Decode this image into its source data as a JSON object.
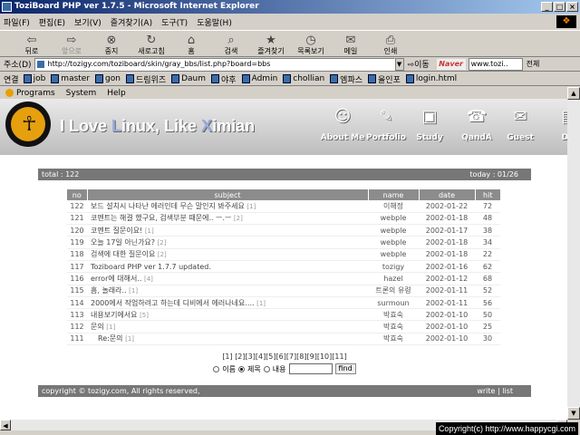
{
  "window": {
    "title": "ToziBoard PHP ver 1.7.5 - Microsoft Internet Explorer"
  },
  "menu": [
    "파일(F)",
    "편집(E)",
    "보기(V)",
    "즐겨찾기(A)",
    "도구(T)",
    "도움말(H)"
  ],
  "toolbar": [
    {
      "label": "뒤로",
      "icon": "back-arrow-icon",
      "glyph": "⇦"
    },
    {
      "label": "앞으로",
      "icon": "forward-arrow-icon",
      "glyph": "⇨",
      "disabled": true
    },
    {
      "label": "중지",
      "icon": "stop-icon",
      "glyph": "⊗"
    },
    {
      "label": "새로고침",
      "icon": "refresh-icon",
      "glyph": "↻"
    },
    {
      "label": "홈",
      "icon": "home-icon",
      "glyph": "⌂"
    },
    {
      "label": "검색",
      "icon": "search-icon",
      "glyph": "⌕"
    },
    {
      "label": "즐겨찾기",
      "icon": "favorites-icon",
      "glyph": "★"
    },
    {
      "label": "목록보기",
      "icon": "history-icon",
      "glyph": "◷"
    },
    {
      "label": "메일",
      "icon": "mail-icon",
      "glyph": "✉"
    },
    {
      "label": "인쇄",
      "icon": "print-icon",
      "glyph": "⎙"
    }
  ],
  "address": {
    "label": "주소(D)",
    "url": "http://tozigy.com/toziboard/skin/gray_bbs/list.php?board=bbs",
    "go_label": "이동",
    "naver_label": "Naver",
    "naver_value": "www.tozi..",
    "naver_right": "전체"
  },
  "links": {
    "label": "연결",
    "items": [
      "job",
      "master",
      "gon",
      "드림위즈",
      "Daum",
      "야후",
      "Admin",
      "chollian",
      "엠파스",
      "올인포",
      "login.html"
    ]
  },
  "programs_bar": [
    "Programs",
    "System",
    "Help"
  ],
  "banner": {
    "title_parts": [
      "I Love ",
      "L",
      "inux, Like ",
      "X",
      "imian"
    ],
    "nav": [
      {
        "label": "About Me",
        "icon": "about-me-icon",
        "glyph": "☺"
      },
      {
        "label": "Portfolio",
        "icon": "portfolio-icon",
        "glyph": "✎"
      },
      {
        "label": "Study",
        "icon": "study-icon",
        "glyph": "▣"
      },
      {
        "label": "QandA",
        "icon": "qanda-icon",
        "glyph": "☎"
      },
      {
        "label": "Guest",
        "icon": "guest-icon",
        "glyph": "✉"
      },
      {
        "label": "Dia",
        "icon": "diary-icon",
        "glyph": "▤"
      }
    ]
  },
  "board": {
    "total": "total : 122",
    "today": "today : 01/26",
    "headers": {
      "no": "no",
      "subject": "subject",
      "name": "name",
      "date": "date",
      "hit": "hit"
    },
    "rows": [
      {
        "no": "122",
        "subject": "보드 설치시 나타난 에러인데 무슨 말인지 봐주세요",
        "count": "[1]",
        "name": "이해정",
        "date": "2002-01-22",
        "hit": "72"
      },
      {
        "no": "121",
        "subject": "코멘트는 해결 했구요, 검색부분 때문에.. ㅡ.ㅡ",
        "count": "[2]",
        "name": "webple",
        "date": "2002-01-18",
        "hit": "48"
      },
      {
        "no": "120",
        "subject": "코멘트 질문이요!",
        "count": "[1]",
        "name": "webple",
        "date": "2002-01-17",
        "hit": "38"
      },
      {
        "no": "119",
        "subject": "오늘 17일 아닌가요?",
        "count": "[2]",
        "name": "webple",
        "date": "2002-01-18",
        "hit": "34"
      },
      {
        "no": "118",
        "subject": "검색에 대한 질문이요",
        "count": "[2]",
        "name": "webple",
        "date": "2002-01-18",
        "hit": "22"
      },
      {
        "no": "117",
        "subject": "Toziboard PHP ver 1.7.7 updated.",
        "count": "",
        "name": "tozigy",
        "date": "2002-01-16",
        "hit": "62"
      },
      {
        "no": "116",
        "subject": "error에 대해서..",
        "count": "[4]",
        "name": "hazel",
        "date": "2002-01-12",
        "hit": "68"
      },
      {
        "no": "115",
        "subject": "흠, 놀래라..",
        "count": "[1]",
        "name": "트론의 유령",
        "date": "2002-01-11",
        "hit": "52"
      },
      {
        "no": "114",
        "subject": "2000에서 작업하려고 하는데 디비에서 에러나네요....",
        "count": "[1]",
        "name": "surmoun",
        "date": "2002-01-11",
        "hit": "56"
      },
      {
        "no": "113",
        "subject": "내용보기에서요",
        "count": "[5]",
        "name": "박효숙",
        "date": "2002-01-10",
        "hit": "50"
      },
      {
        "no": "112",
        "subject": "문의",
        "count": "[1]",
        "name": "박효숙",
        "date": "2002-01-10",
        "hit": "25"
      },
      {
        "no": "111",
        "subject": "Re:문의",
        "count": "[1]",
        "name": "박효숙",
        "date": "2002-01-10",
        "hit": "30",
        "reply": true
      }
    ],
    "pages": "[1] [2][3][4][5][6][7][8][9][10][11]",
    "search": {
      "opt_name": "이름",
      "opt_title": "제목",
      "opt_content": "내용",
      "button": "find"
    },
    "footer_left": "copyright © tozigy.com, All rights reserved,",
    "footer_right": "write  |  list"
  },
  "overlay_copyright": "Copyright(c) http://www.happycgi.com"
}
